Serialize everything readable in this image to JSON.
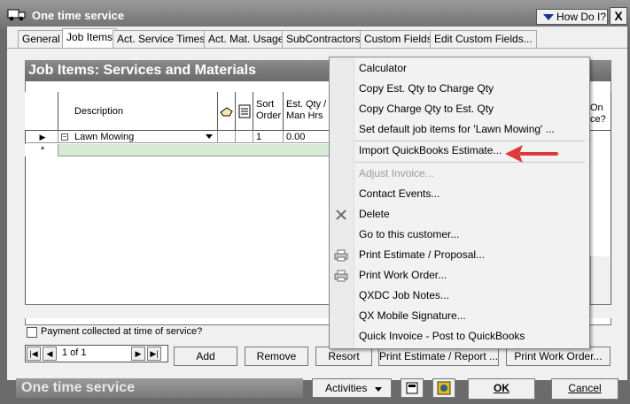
{
  "window": {
    "title": "One time service",
    "how_do_i": "How Do I?",
    "close": "X"
  },
  "tabs": [
    {
      "label": "General"
    },
    {
      "label": "Job Items"
    },
    {
      "label": "Act. Service Times"
    },
    {
      "label": "Act. Mat. Usage"
    },
    {
      "label": "SubContractors"
    },
    {
      "label": "Custom Fields"
    },
    {
      "label": "Edit Custom Fields..."
    }
  ],
  "panel": {
    "title": "Job Items: Services and Materials",
    "columns": {
      "description": "Description",
      "sort": "Sort Order",
      "est_qty": "Est. Qty / Man Hrs",
      "on_service": "On ce?"
    },
    "rows": [
      {
        "description": "Lawn Mowing",
        "sort": "1",
        "est_qty": "0.00"
      }
    ],
    "new_row_marker": "*",
    "current_row_marker": "▶"
  },
  "footer": {
    "payment_label": "Payment collected at time of service?",
    "pager": "1 of 1",
    "buttons": {
      "add": "Add",
      "remove": "Remove",
      "resort": "Resort",
      "print_estimate": "Print Estimate / Report ...",
      "print_work_order": "Print Work Order..."
    }
  },
  "statusbar": {
    "title": "One time service",
    "activities": "Activities",
    "ok": "OK",
    "cancel": "Cancel"
  },
  "context_menu": {
    "items": [
      {
        "label": "Calculator",
        "disabled": false,
        "icon": ""
      },
      {
        "label": "Copy Est. Qty to Charge Qty",
        "disabled": false,
        "icon": ""
      },
      {
        "label": "Copy Charge Qty to Est. Qty",
        "disabled": false,
        "icon": ""
      },
      {
        "label": "Set default job items for 'Lawn Mowing' ...",
        "disabled": false,
        "icon": ""
      },
      {
        "label": "Import QuickBooks Estimate...",
        "disabled": false,
        "icon": ""
      },
      {
        "label": "Adjust Invoice...",
        "disabled": true,
        "icon": ""
      },
      {
        "label": "Contact Events...",
        "disabled": false,
        "icon": ""
      },
      {
        "label": "Delete",
        "disabled": false,
        "icon": "delete-x-icon"
      },
      {
        "label": "Go to this customer...",
        "disabled": false,
        "icon": ""
      },
      {
        "label": "Print Estimate / Proposal...",
        "disabled": false,
        "icon": "printer-icon"
      },
      {
        "label": "Print Work Order...",
        "disabled": false,
        "icon": "printer-icon"
      },
      {
        "label": "QXDC Job Notes...",
        "disabled": false,
        "icon": ""
      },
      {
        "label": "QX Mobile Signature...",
        "disabled": false,
        "icon": ""
      },
      {
        "label": "Quick Invoice - Post to QuickBooks",
        "disabled": false,
        "icon": ""
      }
    ]
  },
  "colors": {
    "annotation_arrow": "#e0393a",
    "title_bar": "#7a7a7a",
    "howdoi_triangle": "#1b2f9a"
  }
}
